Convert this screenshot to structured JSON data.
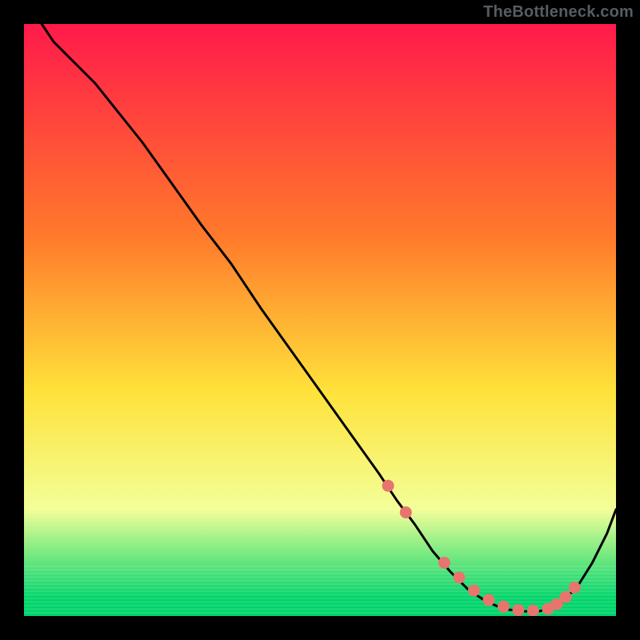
{
  "watermark": "TheBottleneck.com",
  "colors": {
    "background": "#000000",
    "curve": "#000000",
    "marker_fill": "#e8756d",
    "marker_stroke": "#e8756d",
    "gradient_top": "#ff1a4a",
    "gradient_mid1": "#ff7a2b",
    "gradient_mid2": "#ffe23a",
    "gradient_mid3": "#f3ff99",
    "gradient_bottom": "#00d46a"
  },
  "chart_data": {
    "type": "line",
    "title": "",
    "xlabel": "",
    "ylabel": "",
    "xlim": [
      0,
      100
    ],
    "ylim": [
      0,
      100
    ],
    "curve": {
      "x": [
        3,
        5,
        8,
        12,
        16,
        20,
        25,
        30,
        35,
        40,
        45,
        50,
        55,
        60,
        63,
        66,
        69,
        72,
        75,
        78,
        81,
        84,
        87,
        89,
        91,
        93.5,
        96,
        98.5,
        100
      ],
      "y": [
        100,
        97,
        94,
        90,
        85,
        80,
        73,
        66,
        59.5,
        52,
        45,
        38,
        31,
        24,
        19.5,
        15.5,
        11,
        7.5,
        4.5,
        2.5,
        1.2,
        0.8,
        0.8,
        1.3,
        2.5,
        5,
        9,
        14,
        18
      ]
    },
    "markers": {
      "x": [
        61.5,
        64.5,
        71,
        73.5,
        76,
        78.5,
        81,
        83.5,
        86,
        88.5,
        90,
        91.5,
        93
      ],
      "y": [
        22,
        17.5,
        9,
        6.5,
        4.3,
        2.7,
        1.6,
        1.0,
        0.9,
        1.2,
        2.0,
        3.2,
        4.8
      ]
    },
    "gradient_stops": [
      {
        "offset": 0.0,
        "color_key": "gradient_top"
      },
      {
        "offset": 0.36,
        "color_key": "gradient_mid1"
      },
      {
        "offset": 0.62,
        "color_key": "gradient_mid2"
      },
      {
        "offset": 0.82,
        "color_key": "gradient_mid3"
      },
      {
        "offset": 0.97,
        "color_key": "gradient_bottom"
      },
      {
        "offset": 1.0,
        "color_key": "gradient_bottom"
      }
    ]
  }
}
